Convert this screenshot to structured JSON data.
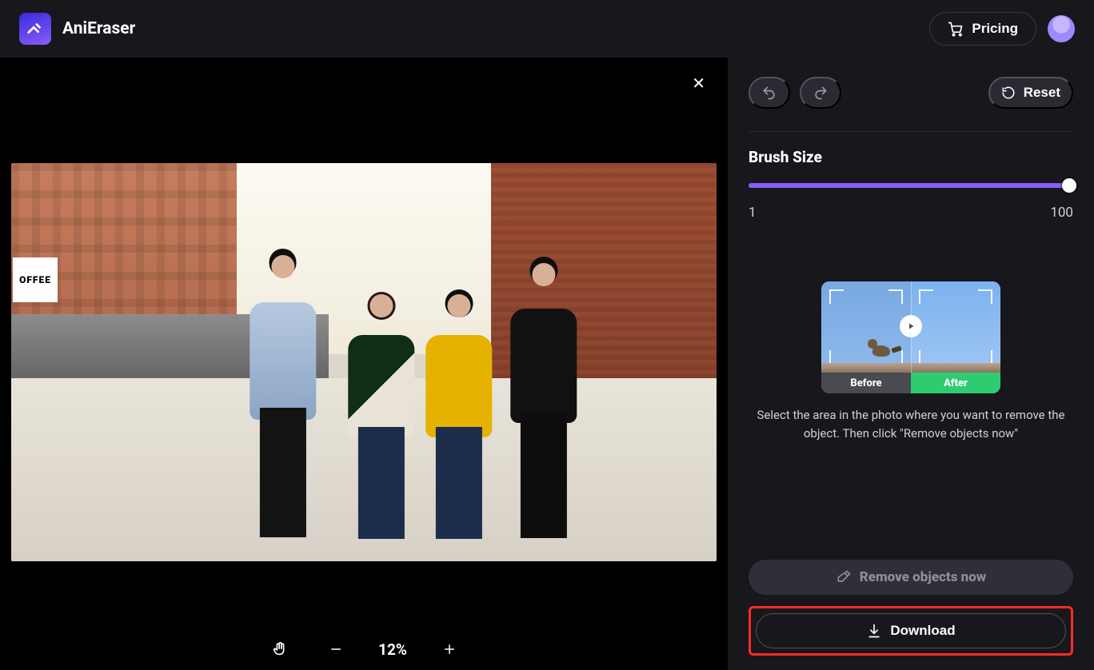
{
  "header": {
    "brand": "AniEraser",
    "pricing_label": "Pricing"
  },
  "canvas": {
    "sign_text": "OFFEE",
    "zoom_label": "12%"
  },
  "panel": {
    "reset_label": "Reset",
    "brush_title": "Brush Size",
    "brush_min": "1",
    "brush_max": "100",
    "demo_before": "Before",
    "demo_after": "After",
    "hint": "Select the area in the photo where you want to remove the object. Then click \"Remove objects now\"",
    "remove_label": "Remove objects now",
    "download_label": "Download"
  }
}
